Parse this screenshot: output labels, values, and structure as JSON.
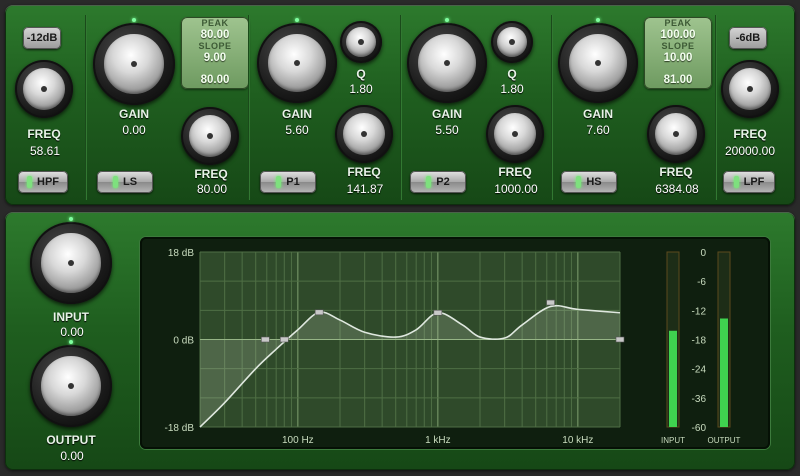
{
  "hpf": {
    "db_label": "-12dB",
    "freq_label": "FREQ",
    "freq_value": "58.61",
    "button": "HPF"
  },
  "ls": {
    "gain_label": "GAIN",
    "gain_value": "0.00",
    "freq_label": "FREQ",
    "freq_value": "80.00",
    "button": "LS",
    "shape": {
      "top": "80.00",
      "slope_label": "SLOPE",
      "mid": "9.00",
      "bottom": "80.00",
      "top_label": "PEAK"
    }
  },
  "p1": {
    "gain_label": "GAIN",
    "gain_value": "5.60",
    "q_label": "Q",
    "q_value": "1.80",
    "freq_label": "FREQ",
    "freq_value": "141.87",
    "button": "P1"
  },
  "p2": {
    "gain_label": "GAIN",
    "gain_value": "5.50",
    "q_label": "Q",
    "q_value": "1.80",
    "freq_label": "FREQ",
    "freq_value": "1000.00",
    "button": "P2"
  },
  "hs": {
    "gain_label": "GAIN",
    "gain_value": "7.60",
    "freq_label": "FREQ",
    "freq_value": "6384.08",
    "button": "HS",
    "shape": {
      "top_label": "PEAK",
      "top": "100.00",
      "slope_label": "SLOPE",
      "mid": "10.00",
      "bottom": "81.00"
    }
  },
  "lpf": {
    "db_label": "-6dB",
    "freq_label": "FREQ",
    "freq_value": "20000.00",
    "button": "LPF"
  },
  "input": {
    "label": "INPUT",
    "value": "0.00"
  },
  "output": {
    "label": "OUTPUT",
    "value": "0.00"
  },
  "graph": {
    "y_labels": [
      "18 dB",
      "0 dB",
      "-18 dB"
    ],
    "x_labels": [
      "100 Hz",
      "1 kHz",
      "10 kHz"
    ],
    "meter_scale": [
      "0",
      "-6",
      "-12",
      "-18",
      "-24",
      "-36",
      "-60"
    ],
    "meter_input_label": "INPUT",
    "meter_output_label": "OUTPUT",
    "meter_input_level": 0.55,
    "meter_output_level": 0.62
  },
  "chart_data": {
    "type": "line",
    "xscale": "log",
    "x_range_hz": [
      20,
      20000
    ],
    "ylim_db": [
      -18,
      18
    ],
    "x": [
      20,
      30,
      50,
      70,
      100,
      142,
      200,
      300,
      500,
      700,
      1000,
      1500,
      2000,
      3000,
      4000,
      6384,
      10000,
      20000
    ],
    "values": [
      -18,
      -13,
      -6,
      -2,
      2,
      5.6,
      4,
      1.5,
      0.5,
      2,
      5.5,
      3,
      0.5,
      0.3,
      3,
      6.8,
      6.2,
      5.5
    ]
  },
  "colors": {
    "panel": "#1f5e1f",
    "accent": "#7fff9f",
    "curve": "#dfe8df"
  }
}
